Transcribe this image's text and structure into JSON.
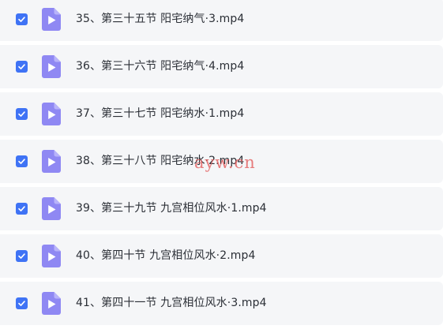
{
  "files": [
    {
      "name": "35、第三十五节 阳宅纳气·3.mp4",
      "checked": true,
      "icon": "video-file-icon"
    },
    {
      "name": "36、第三十六节 阳宅纳气·4.mp4",
      "checked": true,
      "icon": "video-file-icon"
    },
    {
      "name": "37、第三十七节 阳宅纳水·1.mp4",
      "checked": true,
      "icon": "video-file-icon"
    },
    {
      "name": "38、第三十八节 阳宅纳水·2.mp4",
      "checked": true,
      "icon": "video-file-icon"
    },
    {
      "name": "39、第三十九节 九宫相位风水·1.mp4",
      "checked": true,
      "icon": "video-file-icon"
    },
    {
      "name": "40、第四十节 九宫相位风水·2.mp4",
      "checked": true,
      "icon": "video-file-icon"
    },
    {
      "name": "41、第四十一节 九宫相位风水·3.mp4",
      "checked": true,
      "icon": "video-file-icon"
    }
  ],
  "watermark": "ayw.cn",
  "colors": {
    "row_background": "#f5f6f8",
    "checkbox": "#3f73f5",
    "file_icon": "#8f88f3",
    "text": "#2b2f36",
    "watermark": "#e25858"
  }
}
